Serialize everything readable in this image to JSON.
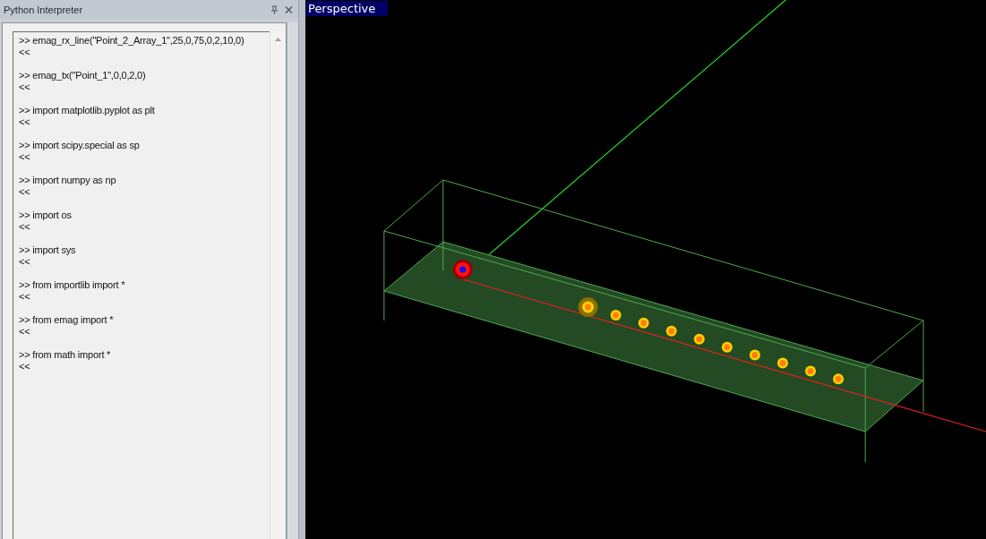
{
  "panel": {
    "title": "Python Interpreter"
  },
  "console": {
    "entries": [
      {
        "input": ">> emag_rx_line(\"Point_2_Array_1\",25,0,75,0,2,10,0)",
        "output": "<<"
      },
      {
        "input": ">> emag_tx(\"Point_1\",0,0,2,0)",
        "output": "<<"
      },
      {
        "input": ">> import matplotlib.pyplot as plt",
        "output": "<<"
      },
      {
        "input": ">> import scipy.special as sp",
        "output": "<<"
      },
      {
        "input": ">> import numpy as np",
        "output": "<<"
      },
      {
        "input": ">> import os",
        "output": "<<"
      },
      {
        "input": ">> import sys",
        "output": "<<"
      },
      {
        "input": ">> from importlib import *",
        "output": "<<"
      },
      {
        "input": ">> from emag import *",
        "output": "<<"
      },
      {
        "input": ">> from math import *",
        "output": "<<"
      }
    ]
  },
  "viewport": {
    "label": "Perspective"
  }
}
